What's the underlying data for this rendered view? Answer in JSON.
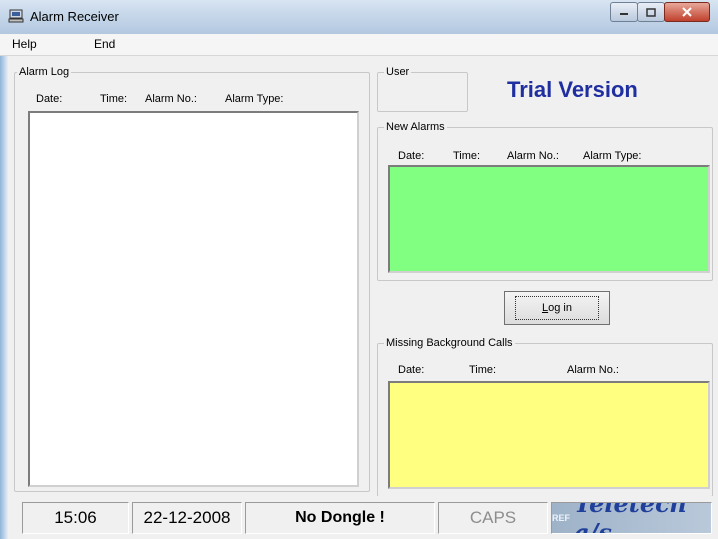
{
  "window": {
    "title": "Alarm Receiver"
  },
  "menu": {
    "items": [
      "Help",
      "End"
    ]
  },
  "alarm_log": {
    "label": "Alarm Log",
    "columns": [
      "Date:",
      "Time:",
      "Alarm No.:",
      "Alarm Type:"
    ]
  },
  "user": {
    "label": "User"
  },
  "trial": {
    "text": "Trial Version",
    "color": "#1f2fa0"
  },
  "new_alarms": {
    "label": "New Alarms",
    "columns": [
      "Date:",
      "Time:",
      "Alarm No.:",
      "Alarm Type:"
    ],
    "bg_color": "#80ff80"
  },
  "login": {
    "label_prefix": "L",
    "label_rest": "og in"
  },
  "missing_calls": {
    "label": "Missing Background Calls",
    "columns": [
      "Date:",
      "Time:",
      "Alarm No.:"
    ],
    "bg_color": "#ffff80"
  },
  "status": {
    "time": "15:06",
    "date": "22-12-2008",
    "dongle": "No Dongle !",
    "caps": "CAPS",
    "logo_small": "REF",
    "logo_text": "Teletech a/s"
  },
  "icons": {
    "app": "computer-icon",
    "minimize": "minimize-icon",
    "maximize": "maximize-icon",
    "close": "close-icon"
  }
}
